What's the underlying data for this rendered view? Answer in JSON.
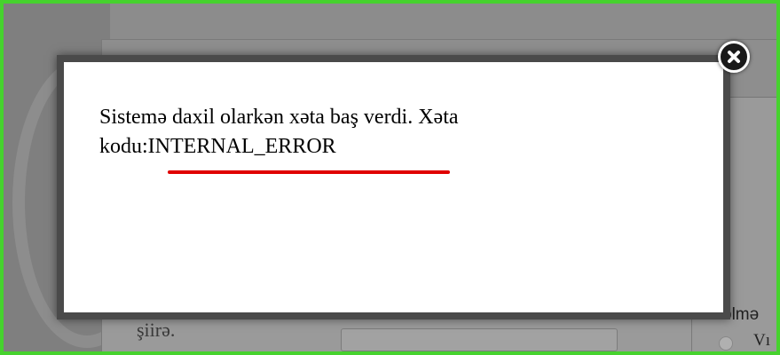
{
  "dialog": {
    "message_line1": "Sistemə daxil olarkən xəta baş verdi. Xəta",
    "message_prefix": "kodu:",
    "error_code": "INTERNAL_ERROR",
    "close_icon": "close-icon"
  },
  "background": {
    "text_left": "şiirə.",
    "text_right": "ölmə",
    "text_option": "Vı"
  },
  "colors": {
    "frame_border": "#46d22e",
    "underline": "#e00000",
    "modal_border": "#4a4a4a"
  }
}
